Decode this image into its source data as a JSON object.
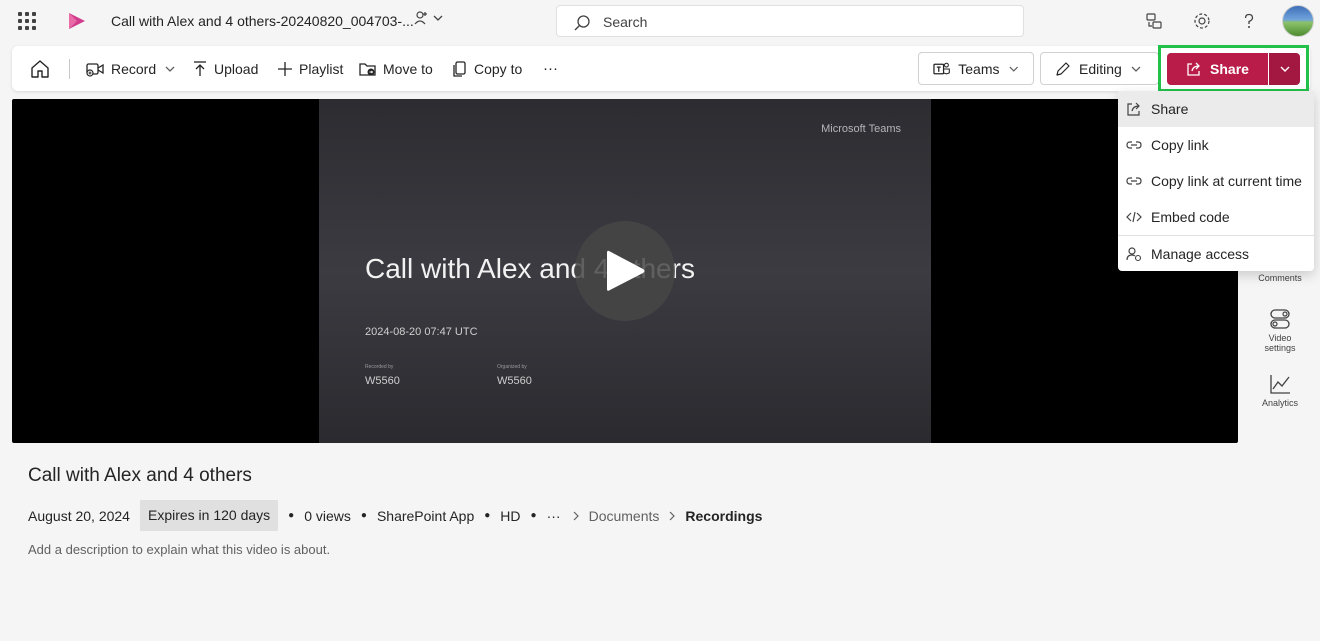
{
  "topbar": {
    "title": "Call with Alex and 4 others-20240820_004703-...",
    "search_placeholder": "Search"
  },
  "toolbar": {
    "record": "Record",
    "upload": "Upload",
    "playlist": "Playlist",
    "move_to": "Move to",
    "copy_to": "Copy to",
    "more": "···",
    "teams": "Teams",
    "editing": "Editing",
    "share": "Share"
  },
  "video": {
    "brand": "Microsoft Teams",
    "slide_title": "Call with Alex and 4 others",
    "date": "2024-08-20 07:47 UTC",
    "recorded_by_label": "Recorded by",
    "recorded_by": "W5560",
    "organized_by_label": "Organized by",
    "organized_by": "W5560"
  },
  "share_menu": {
    "items": [
      "Share",
      "Copy link",
      "Copy link at current time",
      "Embed code",
      "Manage access"
    ]
  },
  "rail": {
    "comments": "Comments",
    "video_settings_1": "Video",
    "video_settings_2": "settings",
    "analytics": "Analytics"
  },
  "details": {
    "title": "Call with Alex and 4 others",
    "date": "August 20, 2024",
    "expires": "Expires in 120 days",
    "views": "0 views",
    "app": "SharePoint App",
    "quality": "HD",
    "more": "···",
    "crumb_documents": "Documents",
    "crumb_recordings": "Recordings",
    "description_placeholder": "Add a description to explain what this video is about."
  },
  "colors": {
    "share_accent": "#b91c48",
    "highlight_border": "#22c14a"
  }
}
